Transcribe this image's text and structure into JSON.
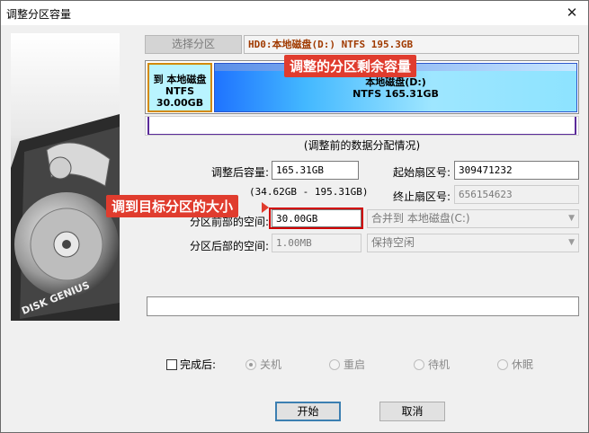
{
  "window": {
    "title": "调整分区容量"
  },
  "toolbar": {
    "select_partition": "选择分区",
    "disk_label": "HD0:本地磁盘(D:) NTFS 195.3GB"
  },
  "partitions": {
    "c": {
      "name": "到 本地磁盘",
      "fs": "NTFS",
      "size": "30.00GB"
    },
    "d": {
      "name": "本地磁盘(D:)",
      "fs_size": "NTFS 165.31GB"
    }
  },
  "caption": "(调整前的数据分配情况)",
  "form": {
    "size_after_label": "调整后容量:",
    "size_after_value": "165.31GB",
    "range": "(34.62GB - 195.31GB)",
    "start_sector_label": "起始扇区号:",
    "start_sector_value": "309471232",
    "end_sector_label": "终止扇区号:",
    "end_sector_value": "656154623",
    "space_before_label": "分区前部的空间:",
    "space_before_value": "30.00GB",
    "space_before_action": "合并到 本地磁盘(C:)",
    "space_after_label": "分区后部的空间:",
    "space_after_value": "1.00MB",
    "space_after_action": "保持空闲"
  },
  "annotations": {
    "remaining": "调整的分区剩余容量",
    "target": "调到目标分区的大小"
  },
  "after_done": {
    "label": "完成后:",
    "options": [
      "关机",
      "重启",
      "待机",
      "休眠"
    ]
  },
  "buttons": {
    "start": "开始",
    "cancel": "取消"
  },
  "side_image": {
    "brand": "DISK GENIUS"
  }
}
